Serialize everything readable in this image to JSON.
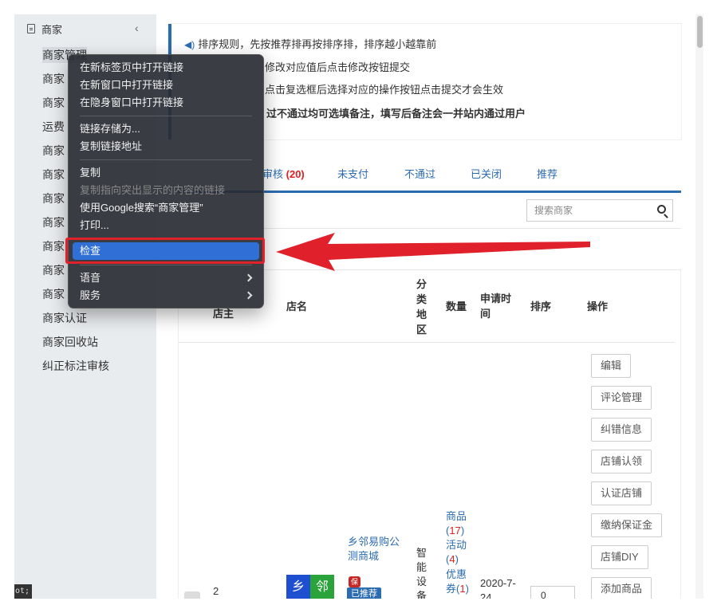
{
  "sidebar": {
    "title": "商家",
    "collapse_icon": "chevron-left-icon",
    "items": [
      {
        "label": "商家管理"
      },
      {
        "label": "商家"
      },
      {
        "label": "商家"
      },
      {
        "label": "运费"
      },
      {
        "label": "商家"
      },
      {
        "label": "商家"
      },
      {
        "label": "商家"
      },
      {
        "label": "商家"
      },
      {
        "label": "商家"
      },
      {
        "label": "商家"
      },
      {
        "label": "商家"
      },
      {
        "label": "商家认证"
      },
      {
        "label": "商家回收站"
      },
      {
        "label": "纠正标注审核"
      }
    ]
  },
  "notice": {
    "line1": "排序规则，先按推荐排再按排序排，排序越小越靠前",
    "line2": "修改对应值后点击修改按钮提交",
    "line3": "点击复选框后选择对应的操作按钮点击提交才会生效",
    "line4": "过不通过均可选填备注，填写后备注会一并站内通过用户"
  },
  "tabs": [
    {
      "label": "审核",
      "count": "(20)"
    },
    {
      "label": "未支付"
    },
    {
      "label": "不通过"
    },
    {
      "label": "已关闭"
    },
    {
      "label": "推荐"
    }
  ],
  "search": {
    "placeholder": "搜索商家"
  },
  "table": {
    "headers": {
      "owner": "店主",
      "name": "店名",
      "category": "分\n类\n地\n区",
      "quantity": "数量",
      "apply_time": "申请时\n间",
      "sort": "排序",
      "ops": "操作"
    },
    "row": {
      "id": "2",
      "shop_name": "乡邻易购公\n测商城",
      "logo_left": "乡",
      "logo_right": "邻",
      "badge_bao": "保",
      "badge_recommend": "已推荐",
      "category": "智\n能\n设\n备",
      "qty_goods_label": "商品",
      "qty_goods_count": "17",
      "qty_activity_label": "活动",
      "qty_activity_count": "4",
      "qty_coupon_label": "优惠\n券",
      "qty_coupon_count": "1",
      "apply_time": "2020-7-\n24",
      "sort_value": "0"
    },
    "operations": [
      "编辑",
      "评论管理",
      "纠错信息",
      "店铺认领",
      "认证店铺",
      "缴纳保证金",
      "店铺DIY",
      "添加商品"
    ]
  },
  "context_menu": {
    "items": [
      {
        "label": "在新标签页中打开链接"
      },
      {
        "label": "在新窗口中打开链接"
      },
      {
        "label": "在隐身窗口中打开链接"
      },
      {
        "label": "链接存储为..."
      },
      {
        "label": "复制链接地址"
      },
      {
        "label": "复制"
      },
      {
        "label": "复制指向突出显示的内容的链接",
        "disabled": true
      },
      {
        "label": "使用Google搜索“商家管理”"
      },
      {
        "label": "打印..."
      },
      {
        "label": "检查",
        "highlighted": true
      },
      {
        "label": "语音",
        "submenu": true
      },
      {
        "label": "服务",
        "submenu": true
      }
    ]
  },
  "status_fragment": "ot;",
  "colors": {
    "accent": "#2b6cb0",
    "highlight": "#2f6fd6",
    "annotation": "#e0202a",
    "menu_bg": "#2a2c34"
  }
}
